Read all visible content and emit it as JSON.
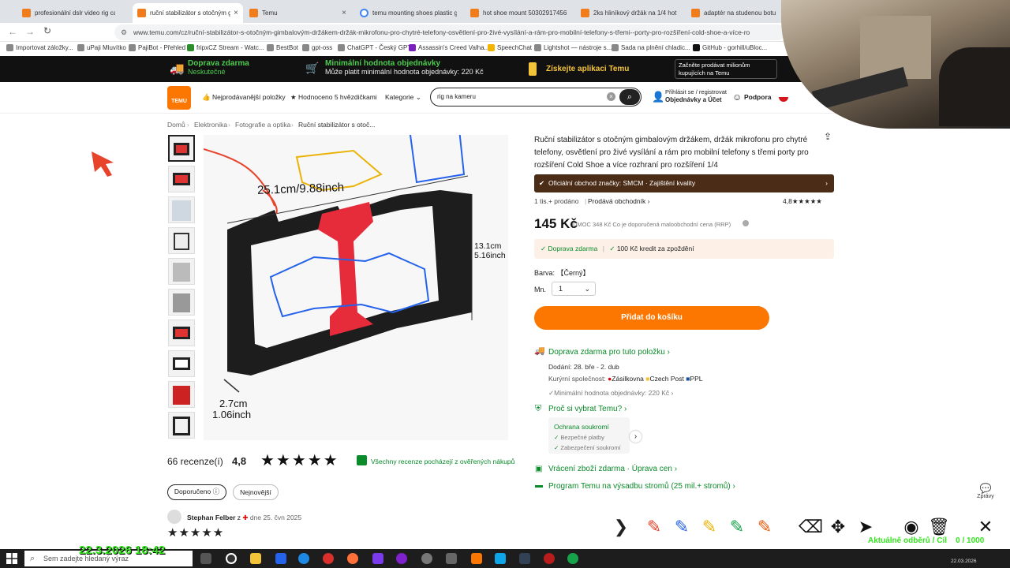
{
  "tabs": [
    {
      "title": "profesionální dslr video rig cage",
      "active": false
    },
    {
      "title": "ruční stabilizátor s otočným gim",
      "active": true
    },
    {
      "title": "Temu",
      "active": false
    },
    {
      "title": "temu mounting shoes plastic gi",
      "active": false
    },
    {
      "title": "hot shoe mount 5030291745679",
      "active": false
    },
    {
      "title": "2ks hliníkový držák na 1/4 hot s",
      "active": false
    },
    {
      "title": "adaptér na studenou botu z hli",
      "active": false
    }
  ],
  "url": "www.temu.com/cz/ruční-stabilizátor-s-otočným-gimbalovým-držákem-držák-mikrofonu-pro-chytré-telefony-osvětlení-pro-živé-vysílání-a-rám-pro-mobilní-telefony-s-třemi--porty-pro-rozšíření-cold-shoe-a-více-ro",
  "bookmarks": [
    "Importovat záložky...",
    "uPaji Mluvítko",
    "PajiBot - Přehled",
    "fripxCZ Stream - Watc...",
    "BestBot",
    "gpt-oss",
    "ChatGPT - Český GPT",
    "Assassin's Creed Valha...",
    "SpeechChat",
    "Lightshot — nástroje s...",
    "Sada na plnění chladic...",
    "GitHub - gorhill/uBloc..."
  ],
  "promo": {
    "free_shipping": "Doprava zdarma",
    "free_shipping_sub": "Neskutečné",
    "min_order": "Minimální hodnota objednávky",
    "min_order_sub": "Může platit minimální hodnota objednávky: 220 Kč",
    "app": "Získejte aplikaci Temu",
    "sell": "Začněte prodávat milionům kupujících na Temu"
  },
  "header": {
    "logo": "TEMU",
    "best_sellers": "Nejprodávanější položky",
    "five_star": "Hodnoceno 5 hvězdičkami",
    "categories": "Kategorie",
    "search_value": "rig na kameru",
    "signin_line1": "Přihlásit se / registrovat",
    "signin_line2": "Objednávky a Účet",
    "support": "Podpora"
  },
  "breadcrumb": [
    "Domů",
    "Elektronika",
    "Fotografie a optika",
    "Ruční stabilizátor s otoč..."
  ],
  "image_dims": {
    "width": "25.1cm/9.88inch",
    "height": "13.1cm\n5.16inch",
    "depth_cm": "2.7cm",
    "depth_in": "1.06inch"
  },
  "product": {
    "title": "Ruční stabilizátor s otočným gimbalovým držákem, držák mikrofonu pro chytré telefony, osvětlení pro živé vysílání a rám pro mobilní telefony s třemi porty pro rozšíření Cold Shoe a více rozhraní pro rozšíření 1/4",
    "store": "Oficiální obchod značky: SMCM · Zajištění kvality",
    "sold": "1 tis.+ prodáno",
    "seller": "Prodává obchodník",
    "rating": "4,8",
    "price": "145 Kč",
    "rrp": "DMOC 348 Kč Co je doporučená maloobchodní cena (RRP)",
    "benefit1": "Doprava zdarma",
    "benefit2": "100 Kč kredit za zpoždění",
    "color_label": "Barva:",
    "color_value": "【Černý】",
    "qty_label": "Mn.",
    "qty_value": "1",
    "add_to_cart": "Přidat do košíku"
  },
  "shipping": {
    "title": "Doprava zdarma pro tuto položku",
    "delivery": "Dodání: 28. bře - 2. dub",
    "couriers_label": "Kurýrní společnost:",
    "couriers": [
      "Zásilkovna",
      "Czech Post",
      "PPL"
    ],
    "min_order": "Minimální hodnota objednávky: 220 Kč"
  },
  "why": {
    "title": "Proč si vybrat Temu?",
    "privacy_title": "Ochrana soukromí",
    "safe_pay": "Bezpečné platby",
    "secure_privacy": "Zabezpečení soukromí"
  },
  "returns": "Vrácení zboží zdarma · Úprava cen",
  "trees": "Program Temu na výsadbu stromů (25 mil.+ stromů)",
  "reviews": {
    "count": "66 recenze(í)",
    "rating": "4,8",
    "verified": "Všechny recenze pocházejí z ověřených nákupů",
    "sort_recommended": "Doporučeno",
    "sort_newest": "Nejnovější",
    "reviewer": "Stephan Felber",
    "review_from": "z",
    "review_date": "dne 25. čvn 2025"
  },
  "messages": "Zprávy",
  "overlay": {
    "datetime": "22.3.2026 18:42",
    "subs_label": "Aktuálně odběrů / Cíl",
    "subs_value": "0 / 1000"
  },
  "taskbar": {
    "search_placeholder": "Sem zadejte hledaný výraz",
    "date": "22.03.2026"
  },
  "colors": {
    "accent": "#fb7701",
    "promo_green": "#4ccc4c",
    "store_bg": "#4a2c17",
    "overlay_green": "#35e51f"
  }
}
